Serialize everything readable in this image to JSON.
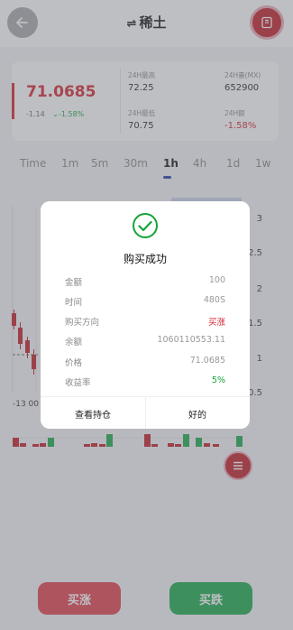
{
  "header": {
    "title": "稀土",
    "swap_symbol": "⇌"
  },
  "stats": {
    "price": "71.0685",
    "change_abs": "-1.14",
    "change_arrow": "⌄",
    "change_pct": "-1.58%",
    "high_label": "24H最高",
    "high_value": "72.25",
    "volume_label": "24H量(MX)",
    "volume_value": "652900",
    "low_label": "24H最低",
    "low_value": "70.75",
    "amount_label": "24H额",
    "amount_value": "-1.58%"
  },
  "intervals": [
    "Time",
    "1m",
    "5m",
    "30m",
    "1h",
    "4h",
    "1d",
    "1w"
  ],
  "active_interval": "1h",
  "chart": {
    "y_ticks": [
      "3",
      "2.5",
      "2",
      "1.5",
      "1",
      "0.5"
    ],
    "x_tick": "-13 00"
  },
  "buttons": {
    "buy_up": "买涨",
    "buy_down": "买跌"
  },
  "modal": {
    "title": "购买成功",
    "rows": [
      {
        "label": "金额",
        "value": "100"
      },
      {
        "label": "时间",
        "value": "480S"
      },
      {
        "label": "购买方向",
        "value": "买涨"
      },
      {
        "label": "余额",
        "value": "1060110553.11"
      },
      {
        "label": "价格",
        "value": "71.0685"
      },
      {
        "label": "收益率",
        "value": "5%"
      }
    ],
    "view_positions": "查看持仓",
    "ok": "好的"
  },
  "colors": {
    "red": "#d5222e",
    "green": "#18a33b",
    "accent_blue": "#1f3fa8"
  }
}
